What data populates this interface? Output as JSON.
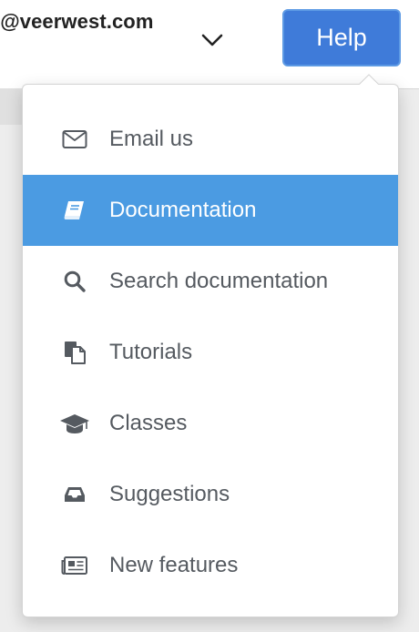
{
  "header": {
    "account_email": "l@veerwest.com",
    "account_menu_icon": "chevron-down-icon",
    "help_label": "Help"
  },
  "help_menu": {
    "items": [
      {
        "label": "Email us",
        "icon": "envelope-icon"
      },
      {
        "label": "Documentation",
        "icon": "book-icon",
        "active": true
      },
      {
        "label": "Search documentation",
        "icon": "search-icon"
      },
      {
        "label": "Tutorials",
        "icon": "copy-icon"
      },
      {
        "label": "Classes",
        "icon": "graduation-cap-icon"
      },
      {
        "label": "Suggestions",
        "icon": "inbox-icon"
      },
      {
        "label": "New features",
        "icon": "newspaper-icon"
      }
    ]
  },
  "colors": {
    "help_button": "#3f7bd9",
    "active_item": "#4b9be2",
    "item_text": "#555a60"
  }
}
